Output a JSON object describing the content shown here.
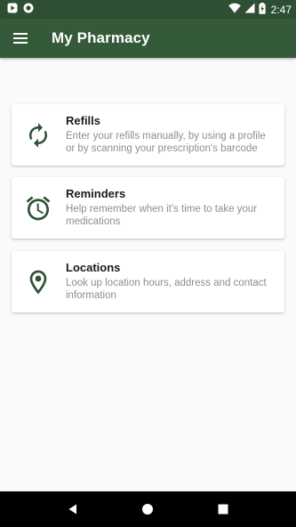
{
  "status_bar": {
    "time": "2:47",
    "left_icons": [
      "play-store-notification-icon",
      "circle-notification-icon"
    ],
    "right_icons": [
      "wifi-icon",
      "cell-signal-icon",
      "battery-charging-icon"
    ]
  },
  "app_bar": {
    "title": "My Pharmacy",
    "menu_icon": "hamburger-menu-icon",
    "background": "#355a39"
  },
  "cards": [
    {
      "title": "Refills",
      "description": "Enter your refills manually, by using a profile or by scanning your prescription's barcode",
      "icon": "refresh-icon"
    },
    {
      "title": "Reminders",
      "description": "Help remember when it's time to take your medications",
      "icon": "alarm-clock-icon"
    },
    {
      "title": "Locations",
      "description": "Look up location hours, address and contact information",
      "icon": "location-pin-icon"
    }
  ],
  "nav_bar": {
    "buttons": [
      "back-icon",
      "home-icon",
      "recents-icon"
    ]
  },
  "colors": {
    "primary": "#355a39",
    "status_bar": "#2f4f34",
    "icon": "#2e5234",
    "title_text": "#1a1a1a",
    "secondary_text": "#8e8e8e"
  }
}
